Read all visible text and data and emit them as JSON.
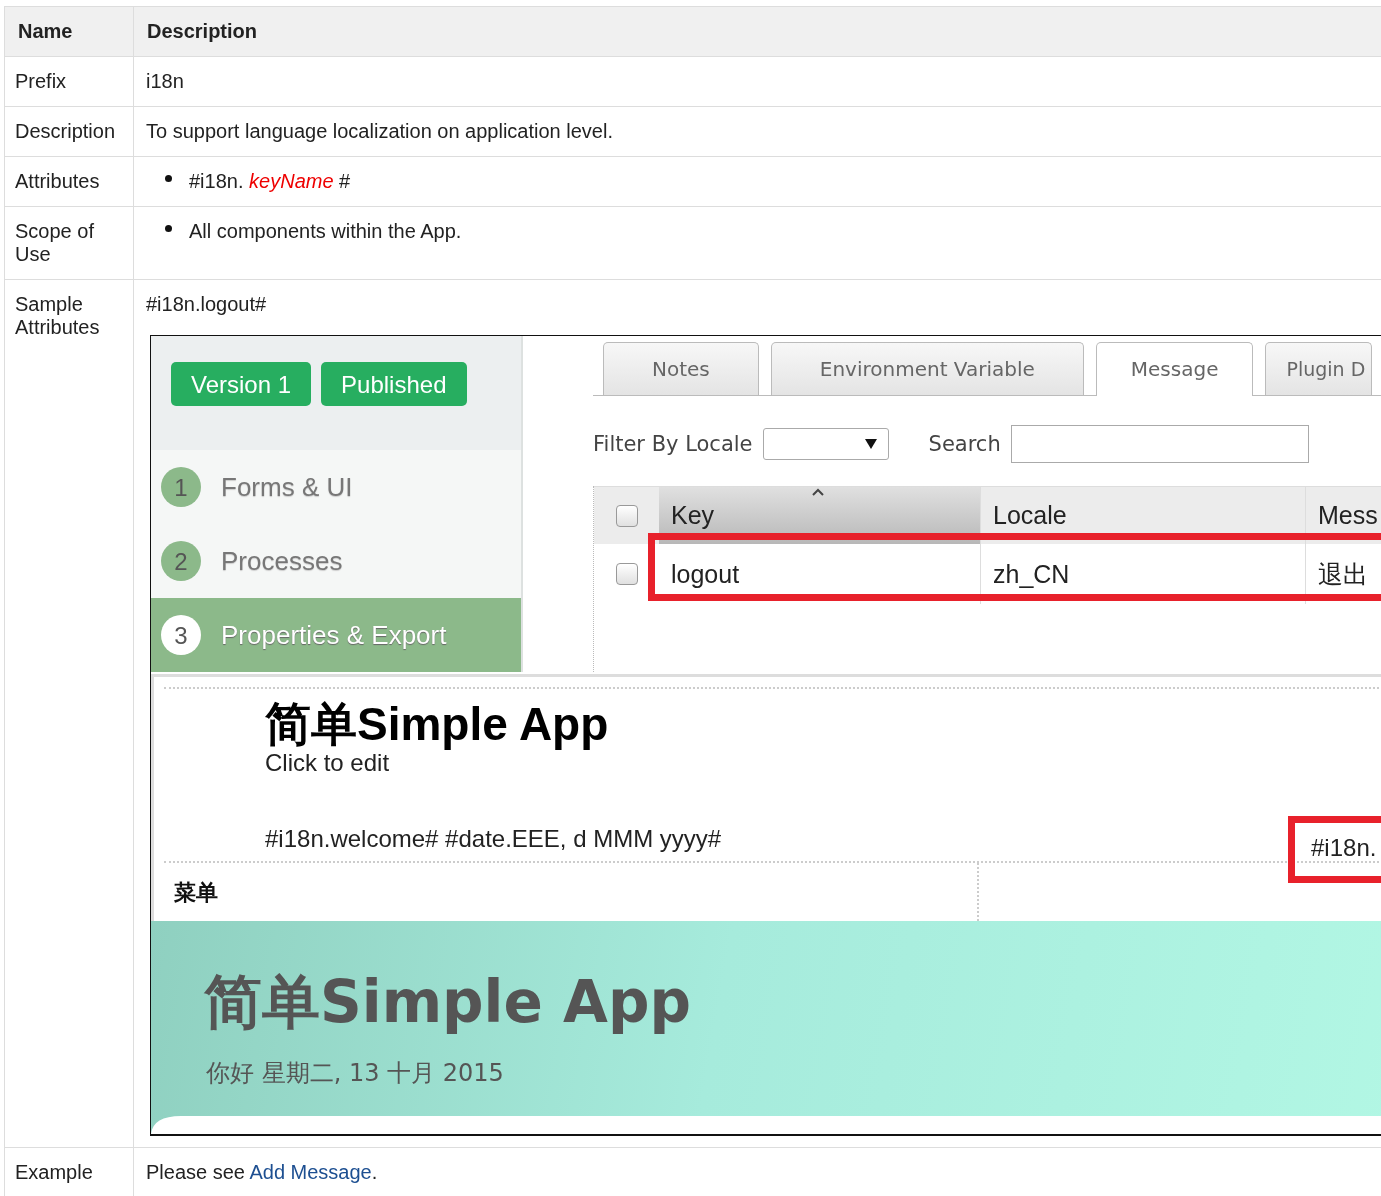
{
  "table": {
    "columns": [
      "Name",
      "Description"
    ],
    "rows": [
      {
        "kind": "text",
        "name": "Prefix",
        "text": "i18n"
      },
      {
        "kind": "text",
        "name": "Description",
        "text": "To support language localization on application level."
      },
      {
        "kind": "bullets",
        "name": "Attributes",
        "items": [
          "#i18n. *keyName* #"
        ]
      },
      {
        "kind": "bullets",
        "name": "Scope of Use",
        "items": [
          "All components within the App."
        ]
      },
      {
        "kind": "sample",
        "name": "Sample Attributes",
        "text": "#i18n.logout#",
        "screenshot": {
          "badges": [
            "Version 1",
            "Published"
          ],
          "steps": [
            {
              "number": "1",
              "label": "Forms & UI",
              "selected": false
            },
            {
              "number": "2",
              "label": "Processes",
              "selected": false
            },
            {
              "number": "3",
              "label": "Properties & Export",
              "selected": true
            }
          ],
          "tabs": [
            {
              "label": "Notes",
              "selected": false
            },
            {
              "label": "Environment Variable",
              "selected": false
            },
            {
              "label": "Message",
              "selected": true
            },
            {
              "label": "Plugin D",
              "selected": false
            }
          ],
          "filter_label": "Filter By Locale",
          "search_label": "Search",
          "grid": {
            "columns": [
              "Key",
              "Locale",
              "Mess"
            ],
            "header_checked": false,
            "rows": [
              {
                "cells": [
                  "logout",
                  "zh_CN",
                  "退出"
                ],
                "checked": false,
                "highlighted": true
              }
            ]
          },
          "preview": {
            "title": "简单Simple App",
            "subtitle": "Click to edit",
            "line": "#i18n.welcome# #date.EEE, d MMM yyyy#",
            "right_text": "#i18n.",
            "right_highlighted": true,
            "menu": "菜单"
          },
          "banner": {
            "title": "简单Simple App",
            "subtitle": "你好 星期二, 13 十月 2015"
          }
        }
      },
      {
        "kind": "link",
        "name": "Example",
        "text": "Please see ",
        "link": "Add Message",
        "after": "."
      }
    ]
  }
}
